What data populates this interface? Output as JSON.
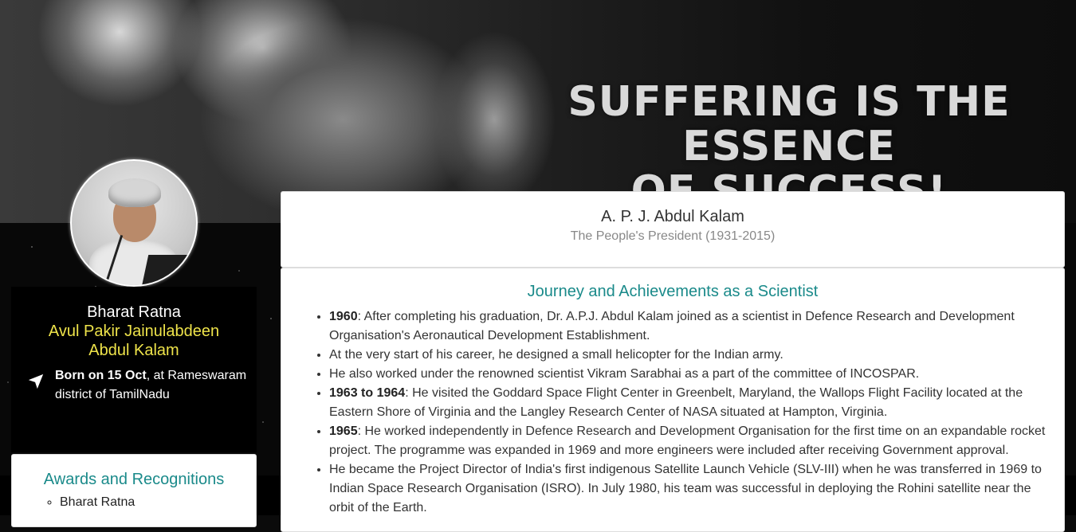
{
  "banner": {
    "quote_line1": "SUFFERING IS THE ESSENCE",
    "quote_line2": "OF SUCCESS!"
  },
  "profile": {
    "title": "Bharat Ratna",
    "name_line1": "Avul Pakir Jainulabdeen",
    "name_line2": "Abdul Kalam",
    "born_bold": "Born on 15 Oct",
    "born_rest": ", at Rameswaram district of TamilNadu",
    "icon": "location-arrow-icon",
    "name_color": "#eee34a"
  },
  "awards": {
    "heading": "Awards and Recognitions",
    "items": [
      "Bharat Ratna"
    ]
  },
  "header": {
    "name": "A. P. J. Abdul Kalam",
    "subtitle": "The People's President (1931-2015)"
  },
  "journey": {
    "heading": "Journey and Achievements as a Scientist",
    "accent_color": "#1a8a8a",
    "items": [
      {
        "bold": "1960",
        "text": ": After completing his graduation, Dr. A.P.J. Abdul Kalam joined as a scientist in Defence Research and Development Organisation's Aeronautical Development Establishment."
      },
      {
        "bold": "",
        "text": "At the very start of his career, he designed a small helicopter for the Indian army."
      },
      {
        "bold": "",
        "text": "He also worked under the renowned scientist Vikram Sarabhai as a part of the committee of INCOSPAR."
      },
      {
        "bold": "1963 to 1964",
        "text": ": He visited the Goddard Space Flight Center in Greenbelt, Maryland, the Wallops Flight Facility located at the Eastern Shore of Virginia and the Langley Research Center of NASA situated at Hampton, Virginia."
      },
      {
        "bold": "1965",
        "text": ": He worked independently in Defence Research and Development Organisation for the first time on an expandable rocket project. The programme was expanded in 1969 and more engineers were included after receiving Government approval."
      },
      {
        "bold": "",
        "text": "He became the Project Director of India's first indigenous Satellite Launch Vehicle (SLV-III) when he was transferred in 1969 to Indian Space Research Organisation (ISRO). In July 1980, his team was successful in deploying the Rohini satellite near the orbit of the Earth."
      }
    ]
  }
}
